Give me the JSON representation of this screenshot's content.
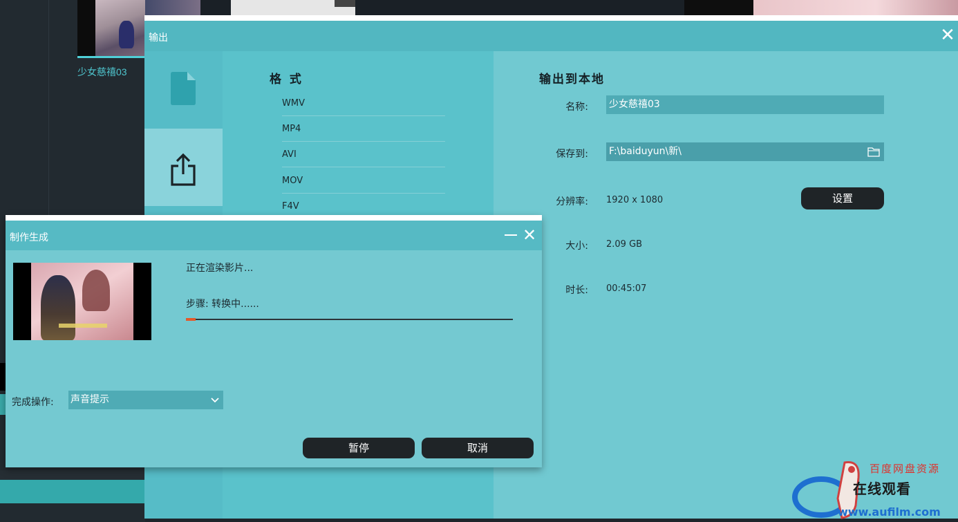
{
  "background": {
    "clip_label": "少女慈禧03"
  },
  "export_dialog": {
    "title": "输出",
    "close_glyph": "✕",
    "formats_heading": "格 式",
    "formats": [
      "WMV",
      "MP4",
      "AVI",
      "MOV",
      "F4V"
    ],
    "settings_heading": "输出到本地",
    "name_label": "名称:",
    "name_value": "少女慈禧03",
    "save_label": "保存到:",
    "save_value": "F:\\baiduyun\\新\\",
    "resolution_label": "分辨率:",
    "resolution_value": "1920 x 1080",
    "settings_button": "设置",
    "size_label": "大小:",
    "size_value": "2.09 GB",
    "duration_label": "时长:",
    "duration_value": "00:45:07",
    "icons": [
      "file-icon",
      "share-export-icon",
      "folder-icon"
    ]
  },
  "progress_dialog": {
    "title": "制作生成",
    "close_glyph": "✕",
    "status": "正在渲染影片...",
    "step": "步骤:  转换中......",
    "progress_fraction": 0.03,
    "completion_label": "完成操作:",
    "completion_value": "声音提示",
    "pause_button": "暂停",
    "cancel_button": "取消",
    "accent_color": "#e35a2b"
  },
  "watermark": {
    "line1": "百度网盘资源",
    "line2": "在线观看",
    "url": "www.aufilm.com"
  }
}
